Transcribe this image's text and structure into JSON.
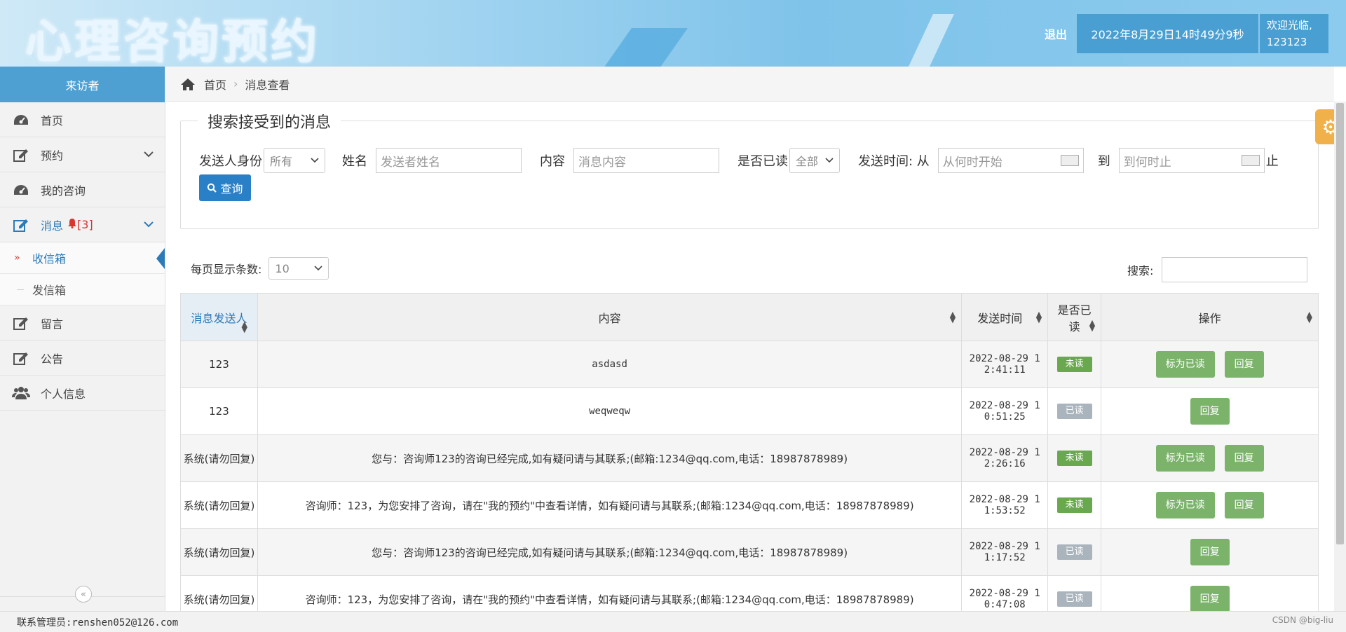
{
  "header": {
    "logo_text": "心理咨询预约",
    "logout_label": "退出",
    "datetime": "2022年8月29日14时49分9秒",
    "welcome": "欢迎光临,",
    "username": "123123"
  },
  "sidebar": {
    "title": "来访者",
    "items": [
      {
        "label": "首页",
        "icon": "dashboard-icon"
      },
      {
        "label": "预约",
        "icon": "edit-icon"
      },
      {
        "label": "我的咨询",
        "icon": "dashboard-icon"
      },
      {
        "label": "消息",
        "icon": "edit-icon",
        "badge": "[3]"
      },
      {
        "label": "留言",
        "icon": "edit-icon"
      },
      {
        "label": "公告",
        "icon": "edit-icon"
      },
      {
        "label": "个人信息",
        "icon": "users-icon"
      }
    ],
    "subitems": [
      {
        "label": "收信箱"
      },
      {
        "label": "发信箱"
      }
    ],
    "collapse_glyph": "«"
  },
  "breadcrumb": {
    "home": "首页",
    "current": "消息查看"
  },
  "search_form": {
    "legend": "搜索接受到的消息",
    "sender_identity_label": "发送人身份",
    "sender_identity_value": "所有",
    "name_label": "姓名",
    "name_placeholder": "发送者姓名",
    "content_label": "内容",
    "content_placeholder": "消息内容",
    "read_label": "是否已读",
    "read_value": "全部",
    "time_label": "发送时间: 从",
    "time_from_placeholder": "从何时开始",
    "to_label": "到",
    "time_to_placeholder": "到何时止",
    "end_label": "止",
    "query_label": "查询"
  },
  "table_tools": {
    "page_size_label": "每页显示条数:",
    "page_size_value": "10",
    "search_label": "搜索:"
  },
  "table": {
    "headers": [
      "消息发送人",
      "内容",
      "发送时间",
      "是否已读",
      "操作"
    ],
    "rows": [
      {
        "sender": "123",
        "content": "asdasd",
        "time1": "2022-08-29 1",
        "time2": "2:41:11",
        "status": "未读"
      },
      {
        "sender": "123",
        "content": "weqweqw",
        "time1": "2022-08-29 1",
        "time2": "0:51:25",
        "status": "已读"
      },
      {
        "sender": "系统(请勿回复)",
        "content": "您与：咨询师123的咨询已经完成,如有疑问请与其联系;(邮箱:1234@qq.com,电话：18987878989)",
        "time1": "2022-08-29 1",
        "time2": "2:26:16",
        "status": "未读"
      },
      {
        "sender": "系统(请勿回复)",
        "content": "咨询师：123，为您安排了咨询，请在\"我的预约\"中查看详情，如有疑问请与其联系;(邮箱:1234@qq.com,电话：18987878989)",
        "time1": "2022-08-29 1",
        "time2": "1:53:52",
        "status": "未读"
      },
      {
        "sender": "系统(请勿回复)",
        "content": "您与：咨询师123的咨询已经完成,如有疑问请与其联系;(邮箱:1234@qq.com,电话：18987878989)",
        "time1": "2022-08-29 1",
        "time2": "1:17:52",
        "status": "已读"
      },
      {
        "sender": "系统(请勿回复)",
        "content": "咨询师：123，为您安排了咨询，请在\"我的预约\"中查看详情，如有疑问请与其联系;(邮箱:1234@qq.com,电话：18987878989)",
        "time1": "2022-08-29 1",
        "time2": "0:47:08",
        "status": "已读"
      }
    ],
    "mark_read_label": "标为已读",
    "reply_label": "回复"
  },
  "footer": {
    "contact": "联系管理员:renshen052@126.com",
    "watermark": "CSDN @big-liu"
  },
  "colors": {
    "accent": "#4e9fd2",
    "button_green": "#7bb36b",
    "query_blue": "#2a80c6",
    "settings_orange": "#f0b04a"
  }
}
